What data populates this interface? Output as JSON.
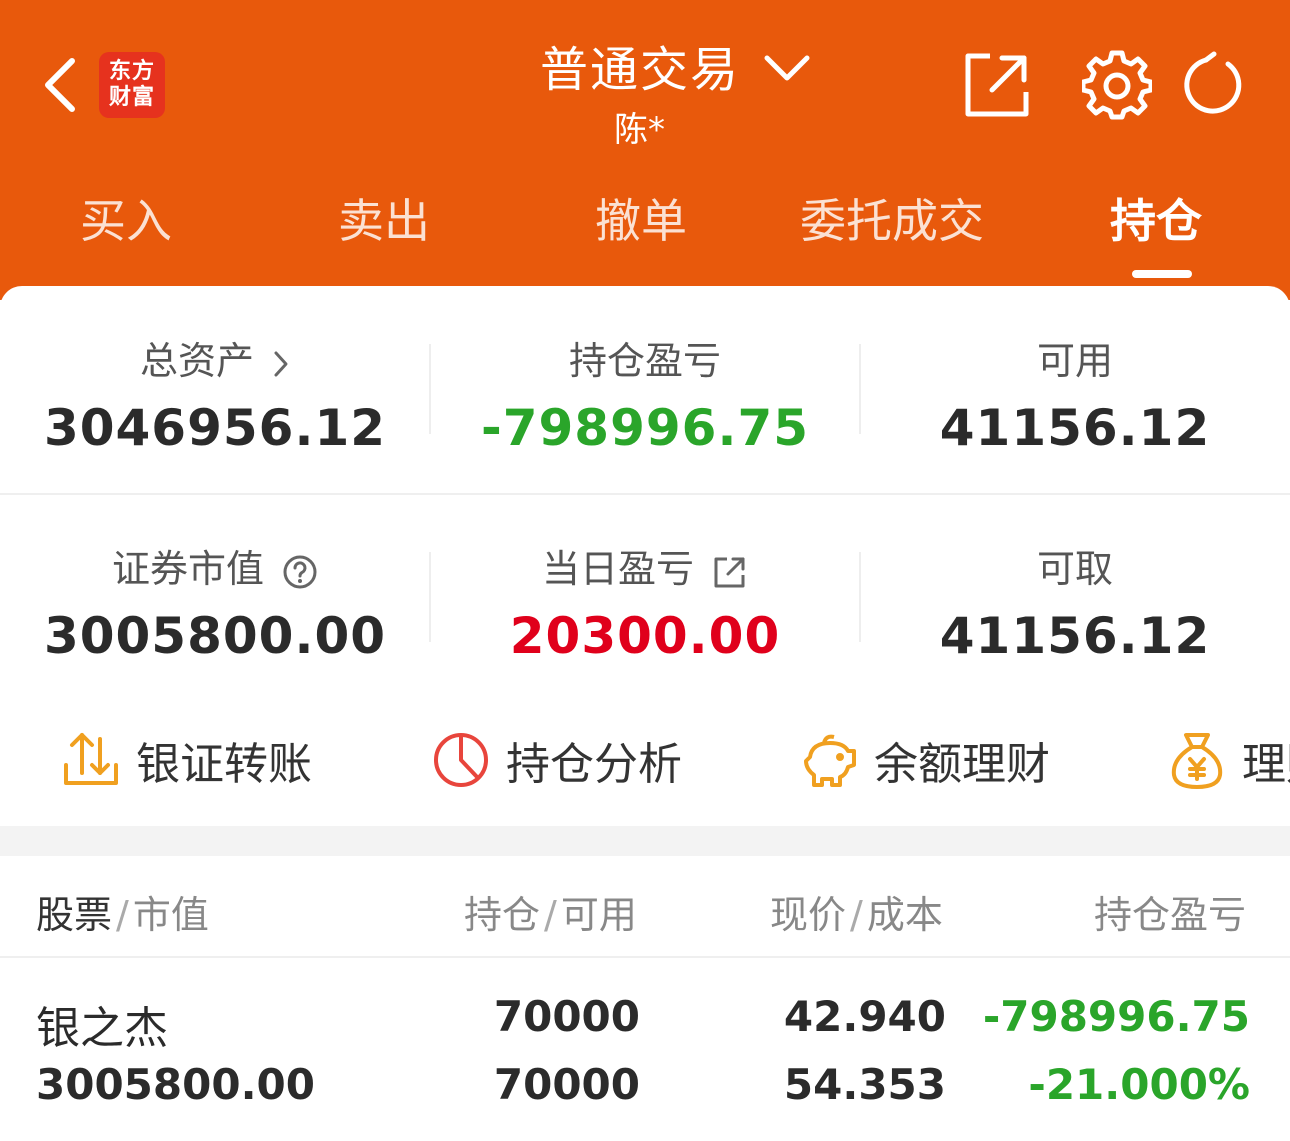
{
  "header": {
    "logo_line1": "东方",
    "logo_line2": "财富",
    "title": "普通交易",
    "account": "陈*",
    "bg_color": "#e8590c"
  },
  "tabs": [
    "买入",
    "卖出",
    "撤单",
    "委托成交",
    "持仓"
  ],
  "active_tab": "持仓",
  "summary": {
    "total_assets_label": "总资产",
    "total_assets": "3046956.12",
    "position_pnl_label": "持仓盈亏",
    "position_pnl": "-798996.75",
    "available_label": "可用",
    "available": "41156.12",
    "market_value_label": "证券市值",
    "market_value": "3005800.00",
    "daily_pnl_label": "当日盈亏",
    "daily_pnl": "20300.00",
    "withdrawable_label": "可取",
    "withdrawable": "41156.12"
  },
  "actions": [
    {
      "label": "银证转账",
      "icon": "transfer-icon"
    },
    {
      "label": "持仓分析",
      "icon": "pie-chart-icon"
    },
    {
      "label": "余额理财",
      "icon": "piggy-bank-icon"
    },
    {
      "label": "理财",
      "icon": "money-bag-icon"
    }
  ],
  "table": {
    "headers": {
      "stock": "股票",
      "market_value": "市值",
      "position": "持仓",
      "available": "可用",
      "price": "现价",
      "cost": "成本",
      "pnl": "持仓盈亏"
    },
    "rows": [
      {
        "name": "银之杰",
        "market_value": "3005800.00",
        "position": "70000",
        "available": "70000",
        "price": "42.940",
        "cost": "54.353",
        "pnl": "-798996.75",
        "pnl_pct": "-21.000%"
      }
    ]
  },
  "colors": {
    "up": "#e0001b",
    "down": "#2aa52a",
    "accent": "#e8590c"
  }
}
